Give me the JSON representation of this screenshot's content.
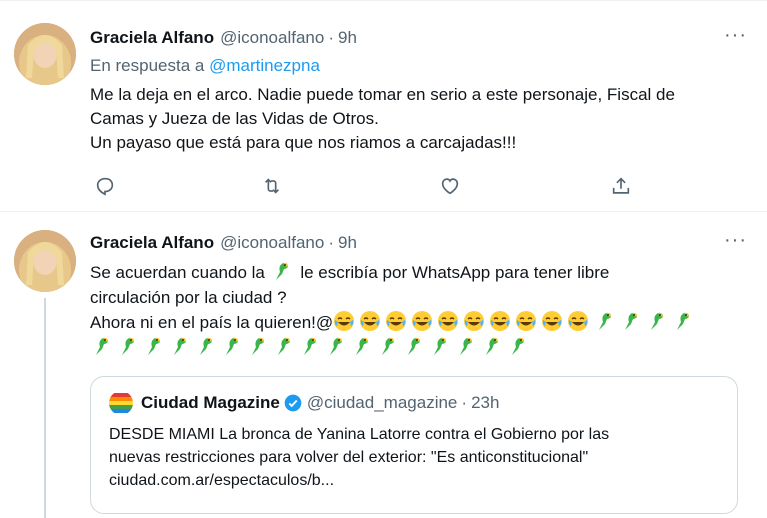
{
  "tweets": [
    {
      "name": "Graciela Alfano",
      "handle": "@iconoalfano",
      "separator": "·",
      "time": "9h",
      "more": "···",
      "reply_prefix": "En respuesta a",
      "reply_to": "@martinezpna",
      "lines": [
        "Me la deja en el arco. Nadie puede tomar en serio a este personaje, Fiscal de",
        "Camas y Jueza de las Vidas de Otros.",
        "Un payaso que está para que nos riamos a carcajadas!!!"
      ],
      "actions": [
        "reply-icon",
        "retweet-icon",
        "like-icon",
        "share-icon"
      ]
    },
    {
      "name": "Graciela Alfano",
      "handle": "@iconoalfano",
      "separator": "·",
      "time": "9h",
      "more": "···",
      "line1_before": "Se acuerdan cuando la",
      "line1_after": "le escribía por WhatsApp para tener libre",
      "line2": "circulación por la ciudad ?",
      "line3": "Ahora ni en el país la quieren!@",
      "emoji_laugh_count": 10,
      "emoji_parrot_line3_count": 4,
      "emoji_parrot_line4_count": 17,
      "quoted": {
        "name": "Ciudad Magazine",
        "handle": "@ciudad_magazine",
        "separator": "·",
        "time": "23h",
        "lines": [
          "DESDE MIAMI La bronca de Yanina Latorre contra el Gobierno por las",
          "nuevas restricciones para volver del exterior: \"Es anticonstitucional\"",
          "ciudad.com.ar/espectaculos/b..."
        ]
      }
    }
  ],
  "colors": {
    "text": "#0f1419",
    "secondary": "#536471",
    "link": "#1d9bf0",
    "border": "#cfd9de"
  }
}
